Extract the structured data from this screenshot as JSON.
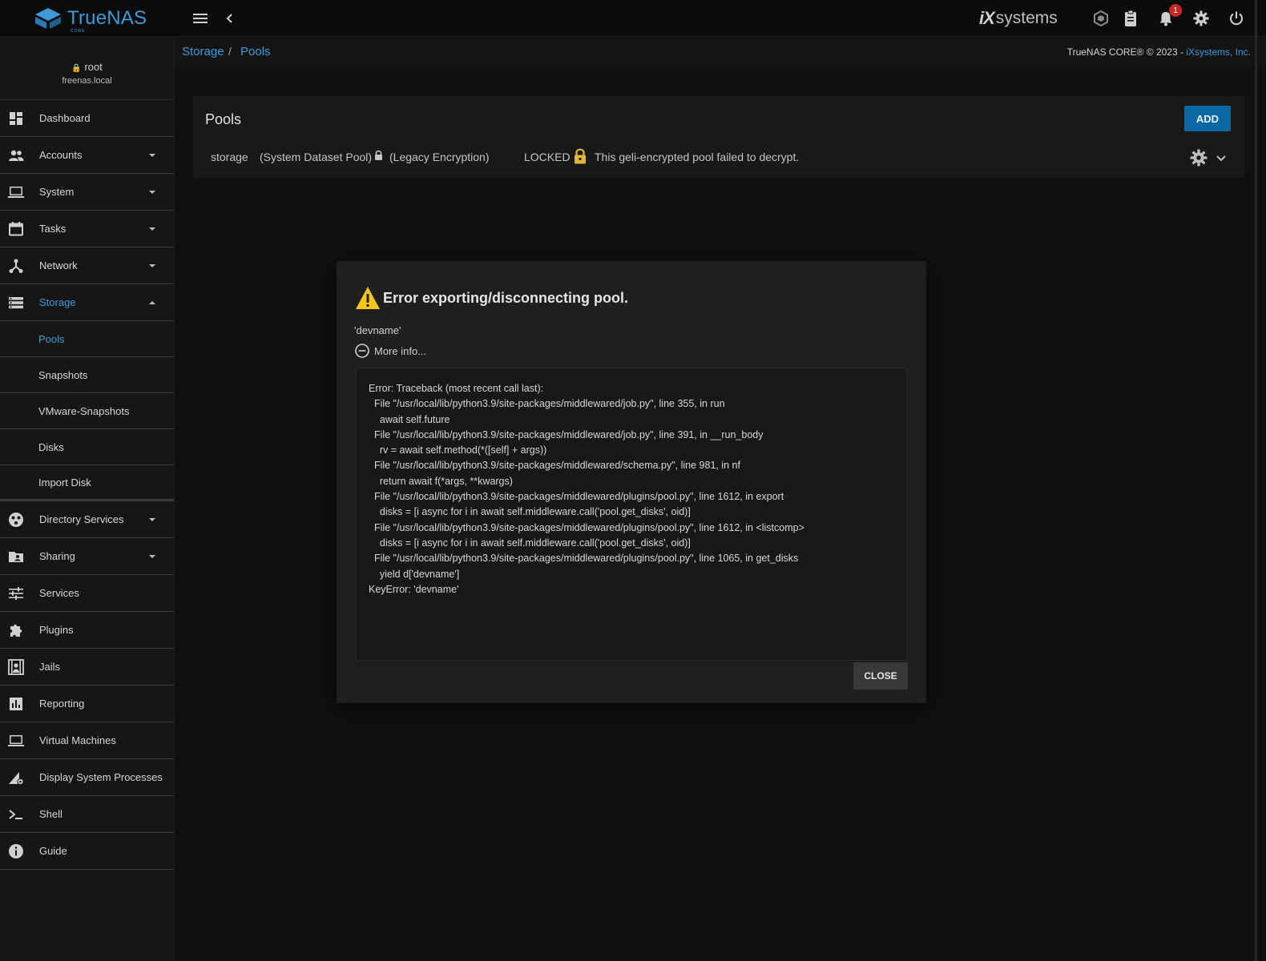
{
  "app": {
    "logo_text": "TrueNAS",
    "logo_sub": "CORE",
    "vendor_mark": "iX",
    "vendor_text": "systems"
  },
  "topbar": {
    "notification_count": "1"
  },
  "user": {
    "name": "root",
    "host": "freenas.local"
  },
  "sidebar": {
    "items": [
      {
        "label": "Dashboard",
        "icon": "dashboard-icon"
      },
      {
        "label": "Accounts",
        "icon": "accounts-icon"
      },
      {
        "label": "System",
        "icon": "laptop-icon"
      },
      {
        "label": "Tasks",
        "icon": "calendar-icon"
      },
      {
        "label": "Network",
        "icon": "network-icon"
      },
      {
        "label": "Storage",
        "icon": "storage-icon"
      }
    ],
    "storage_sub": [
      "Pools",
      "Snapshots",
      "VMware-Snapshots",
      "Disks",
      "Import Disk"
    ],
    "items2": [
      {
        "label": "Directory Services",
        "icon": "directory-icon"
      },
      {
        "label": "Sharing",
        "icon": "folder-share-icon"
      },
      {
        "label": "Services",
        "icon": "sliders-icon"
      },
      {
        "label": "Plugins",
        "icon": "puzzle-icon"
      },
      {
        "label": "Jails",
        "icon": "jail-icon"
      },
      {
        "label": "Reporting",
        "icon": "chart-icon"
      },
      {
        "label": "Virtual Machines",
        "icon": "laptop-icon"
      },
      {
        "label": "Display System Processes",
        "icon": "processes-icon"
      },
      {
        "label": "Shell",
        "icon": "terminal-icon"
      },
      {
        "label": "Guide",
        "icon": "info-icon"
      }
    ]
  },
  "breadcrumb": {
    "first": "Storage",
    "separator": "/",
    "second": "Pools"
  },
  "copyright": {
    "text": "TrueNAS CORE® © 2023 - ",
    "link": "iXsystems, Inc."
  },
  "pools": {
    "title": "Pools",
    "add_label": "ADD",
    "row": {
      "name": "storage",
      "dataset": "(System Dataset Pool)",
      "encryption": "(Legacy Encryption)",
      "status": "LOCKED",
      "message": "This geli-encrypted pool failed to decrypt."
    }
  },
  "dialog": {
    "title": "Error exporting/disconnecting pool.",
    "message": "'devname'",
    "more_info": "More info...",
    "traceback": [
      "Error: Traceback (most recent call last):",
      "  File \"/usr/local/lib/python3.9/site-packages/middlewared/job.py\", line 355, in run",
      "    await self.future",
      "  File \"/usr/local/lib/python3.9/site-packages/middlewared/job.py\", line 391, in __run_body",
      "    rv = await self.method(*([self] + args))",
      "  File \"/usr/local/lib/python3.9/site-packages/middlewared/schema.py\", line 981, in nf",
      "    return await f(*args, **kwargs)",
      "  File \"/usr/local/lib/python3.9/site-packages/middlewared/plugins/pool.py\", line 1612, in export",
      "    disks = [i async for i in await self.middleware.call('pool.get_disks', oid)]",
      "  File \"/usr/local/lib/python3.9/site-packages/middlewared/plugins/pool.py\", line 1612, in <listcomp>",
      "    disks = [i async for i in await self.middleware.call('pool.get_disks', oid)]",
      "  File \"/usr/local/lib/python3.9/site-packages/middlewared/plugins/pool.py\", line 1065, in get_disks",
      "    yield d['devname']",
      "KeyError: 'devname'"
    ],
    "close_label": "CLOSE"
  },
  "colors": {
    "accent": "#3e9ad6",
    "add_button": "#0b68a5",
    "warning": "#f5c518",
    "badge": "#c62828"
  }
}
